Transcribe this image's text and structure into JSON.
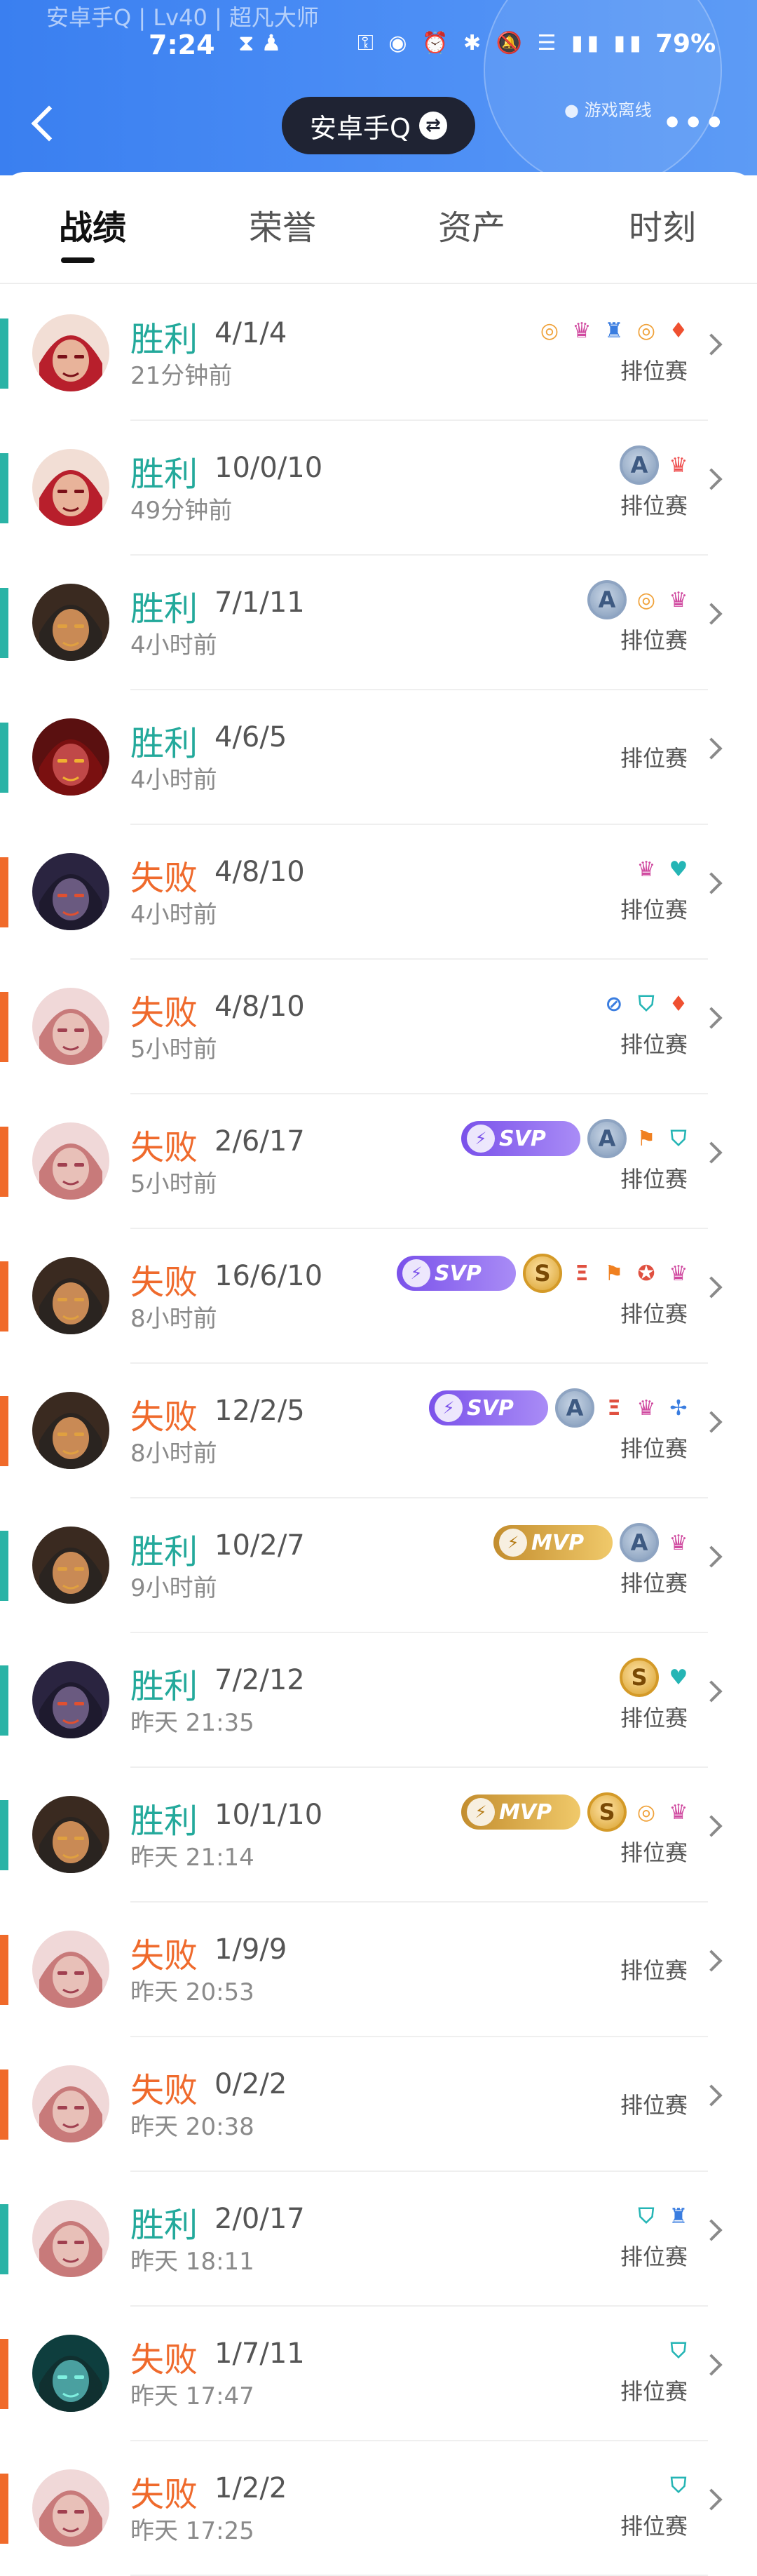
{
  "status_bar": {
    "account_overlay": "安卓手Q | Lv40 | 超凡大师",
    "time": "7:24",
    "time_icons": "⧗ ♟",
    "right_icons": "⚿ ◉ ⏰ ✱ 🔕 ☰ ▮▮ ▮▮",
    "battery": "79%"
  },
  "header": {
    "account_label": "安卓手Q",
    "switch_icon": "⇄",
    "offline_text": "● 游戏离线",
    "more_label": "•••"
  },
  "tabs": [
    {
      "label": "战绩",
      "active": true
    },
    {
      "label": "荣誉",
      "active": false
    },
    {
      "label": "资产",
      "active": false
    },
    {
      "label": "时刻",
      "active": false
    }
  ],
  "colors": {
    "win": "#2ab3a6",
    "loss": "#f06a2a",
    "header_blue": "#4788f3"
  },
  "matches": [
    {
      "result": "胜利",
      "outcome": "win",
      "kda": "4/1/4",
      "time": "21分钟前",
      "mode": "排位赛",
      "hero": "red",
      "badges": [
        {
          "k": "icon",
          "g": "◎",
          "c": "#f0a23a"
        },
        {
          "k": "icon",
          "g": "♛",
          "c": "#d04aa0"
        },
        {
          "k": "icon",
          "g": "♜",
          "c": "#3a7de0"
        },
        {
          "k": "icon",
          "g": "◎",
          "c": "#f0a23a"
        },
        {
          "k": "icon",
          "g": "♦",
          "c": "#ef5030"
        }
      ]
    },
    {
      "result": "胜利",
      "outcome": "win",
      "kda": "10/0/10",
      "time": "49分钟前",
      "mode": "排位赛",
      "hero": "red",
      "badges": [
        {
          "k": "circle",
          "t": "A"
        },
        {
          "k": "icon",
          "g": "♛",
          "c": "#ef5050"
        }
      ]
    },
    {
      "result": "胜利",
      "outcome": "win",
      "kda": "7/1/11",
      "time": "4小时前",
      "mode": "排位赛",
      "hero": "warrior",
      "badges": [
        {
          "k": "circle",
          "t": "A"
        },
        {
          "k": "icon",
          "g": "◎",
          "c": "#f0a23a"
        },
        {
          "k": "icon",
          "g": "♛",
          "c": "#d04aa0"
        }
      ]
    },
    {
      "result": "胜利",
      "outcome": "win",
      "kda": "4/6/5",
      "time": "4小时前",
      "mode": "排位赛",
      "hero": "crimson",
      "badges": []
    },
    {
      "result": "失败",
      "outcome": "loss",
      "kda": "4/8/10",
      "time": "4小时前",
      "mode": "排位赛",
      "hero": "monkey",
      "badges": [
        {
          "k": "icon",
          "g": "♛",
          "c": "#d04aa0"
        },
        {
          "k": "icon",
          "g": "♥",
          "c": "#25b5b5"
        }
      ]
    },
    {
      "result": "失败",
      "outcome": "loss",
      "kda": "4/8/10",
      "time": "5小时前",
      "mode": "排位赛",
      "hero": "pink",
      "badges": [
        {
          "k": "icon",
          "g": "⊘",
          "c": "#3a7de0"
        },
        {
          "k": "icon",
          "g": "⛉",
          "c": "#25b5b5"
        },
        {
          "k": "icon",
          "g": "♦",
          "c": "#ef5030"
        }
      ]
    },
    {
      "result": "失败",
      "outcome": "loss",
      "kda": "2/6/17",
      "time": "5小时前",
      "mode": "排位赛",
      "hero": "pink",
      "badges": [
        {
          "k": "plate",
          "t": "SVP"
        },
        {
          "k": "circle",
          "t": "A"
        },
        {
          "k": "icon",
          "g": "⚑",
          "c": "#f08020"
        },
        {
          "k": "icon",
          "g": "⛉",
          "c": "#25b5b5"
        }
      ]
    },
    {
      "result": "失败",
      "outcome": "loss",
      "kda": "16/6/10",
      "time": "8小时前",
      "mode": "排位赛",
      "hero": "warrior",
      "badges": [
        {
          "k": "plate",
          "t": "SVP"
        },
        {
          "k": "circle",
          "t": "S"
        },
        {
          "k": "icon",
          "g": "Ξ",
          "c": "#e05040"
        },
        {
          "k": "icon",
          "g": "⚑",
          "c": "#f08020"
        },
        {
          "k": "icon",
          "g": "✪",
          "c": "#e05040"
        },
        {
          "k": "icon",
          "g": "♛",
          "c": "#d04aa0"
        }
      ]
    },
    {
      "result": "失败",
      "outcome": "loss",
      "kda": "12/2/5",
      "time": "8小时前",
      "mode": "排位赛",
      "hero": "warrior",
      "badges": [
        {
          "k": "plate",
          "t": "SVP"
        },
        {
          "k": "circle",
          "t": "A"
        },
        {
          "k": "icon",
          "g": "Ξ",
          "c": "#e05040"
        },
        {
          "k": "icon",
          "g": "♛",
          "c": "#d04aa0"
        },
        {
          "k": "icon",
          "g": "✢",
          "c": "#3a7de0"
        }
      ]
    },
    {
      "result": "胜利",
      "outcome": "win",
      "kda": "10/2/7",
      "time": "9小时前",
      "mode": "排位赛",
      "hero": "warrior",
      "badges": [
        {
          "k": "plate",
          "t": "MVP"
        },
        {
          "k": "circle",
          "t": "A"
        },
        {
          "k": "icon",
          "g": "♛",
          "c": "#d04aa0"
        }
      ]
    },
    {
      "result": "胜利",
      "outcome": "win",
      "kda": "7/2/12",
      "time": "昨天 21:35",
      "mode": "排位赛",
      "hero": "monkey",
      "badges": [
        {
          "k": "circle",
          "t": "S"
        },
        {
          "k": "icon",
          "g": "♥",
          "c": "#25b5b5"
        }
      ]
    },
    {
      "result": "胜利",
      "outcome": "win",
      "kda": "10/1/10",
      "time": "昨天 21:14",
      "mode": "排位赛",
      "hero": "warrior",
      "badges": [
        {
          "k": "plate",
          "t": "MVP"
        },
        {
          "k": "circle",
          "t": "S"
        },
        {
          "k": "icon",
          "g": "◎",
          "c": "#f0a23a"
        },
        {
          "k": "icon",
          "g": "♛",
          "c": "#d04aa0"
        }
      ]
    },
    {
      "result": "失败",
      "outcome": "loss",
      "kda": "1/9/9",
      "time": "昨天 20:53",
      "mode": "排位赛",
      "hero": "pink",
      "badges": []
    },
    {
      "result": "失败",
      "outcome": "loss",
      "kda": "0/2/2",
      "time": "昨天 20:38",
      "mode": "排位赛",
      "hero": "pink",
      "badges": []
    },
    {
      "result": "胜利",
      "outcome": "win",
      "kda": "2/0/17",
      "time": "昨天 18:11",
      "mode": "排位赛",
      "hero": "pink",
      "badges": [
        {
          "k": "icon",
          "g": "⛉",
          "c": "#25b5b5"
        },
        {
          "k": "icon",
          "g": "♜",
          "c": "#3a7de0"
        }
      ]
    },
    {
      "result": "失败",
      "outcome": "loss",
      "kda": "1/7/11",
      "time": "昨天 17:47",
      "mode": "排位赛",
      "hero": "teal",
      "badges": [
        {
          "k": "icon",
          "g": "⛉",
          "c": "#25b5b5"
        }
      ]
    },
    {
      "result": "失败",
      "outcome": "loss",
      "kda": "1/2/2",
      "time": "昨天 17:25",
      "mode": "排位赛",
      "hero": "pink",
      "badges": [
        {
          "k": "icon",
          "g": "⛉",
          "c": "#25b5b5"
        }
      ]
    }
  ]
}
